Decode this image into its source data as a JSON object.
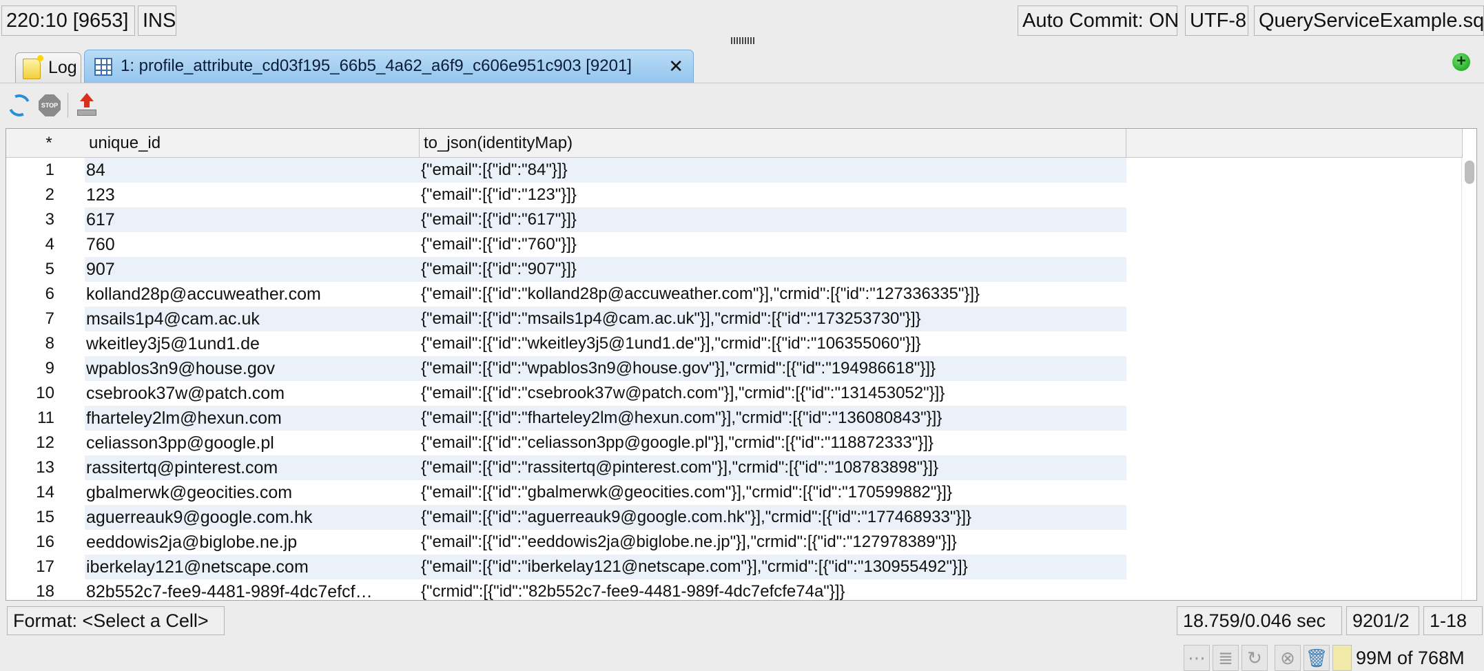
{
  "status_top": {
    "cursor_position": "220:10 [9653]",
    "insert_mode": "INS",
    "auto_commit": "Auto Commit: ON",
    "encoding": "UTF-8",
    "file_name": "QueryServiceExample.sql*"
  },
  "tabs": [
    {
      "label": "Log",
      "icon": "note-icon"
    },
    {
      "label": "1: profile_attribute_cd03f195_66b5_4a62_a6f9_c606e951c903 [9201]",
      "icon": "grid-icon",
      "close": "✕"
    }
  ],
  "toolbar": {
    "stop_label": "STOP"
  },
  "grid": {
    "columns": [
      "*",
      "unique_id",
      "to_json(identityMap)"
    ],
    "rows": [
      {
        "num": "1",
        "unique_id": "84",
        "identity": "{\"email\":[{\"id\":\"84\"}]}"
      },
      {
        "num": "2",
        "unique_id": "123",
        "identity": "{\"email\":[{\"id\":\"123\"}]}"
      },
      {
        "num": "3",
        "unique_id": "617",
        "identity": "{\"email\":[{\"id\":\"617\"}]}"
      },
      {
        "num": "4",
        "unique_id": "760",
        "identity": "{\"email\":[{\"id\":\"760\"}]}"
      },
      {
        "num": "5",
        "unique_id": "907",
        "identity": "{\"email\":[{\"id\":\"907\"}]}"
      },
      {
        "num": "6",
        "unique_id": "kolland28p@accuweather.com",
        "identity": "{\"email\":[{\"id\":\"kolland28p@accuweather.com\"}],\"crmid\":[{\"id\":\"127336335\"}]}"
      },
      {
        "num": "7",
        "unique_id": "msails1p4@cam.ac.uk",
        "identity": "{\"email\":[{\"id\":\"msails1p4@cam.ac.uk\"}],\"crmid\":[{\"id\":\"173253730\"}]}"
      },
      {
        "num": "8",
        "unique_id": "wkeitley3j5@1und1.de",
        "identity": "{\"email\":[{\"id\":\"wkeitley3j5@1und1.de\"}],\"crmid\":[{\"id\":\"106355060\"}]}"
      },
      {
        "num": "9",
        "unique_id": "wpablos3n9@house.gov",
        "identity": "{\"email\":[{\"id\":\"wpablos3n9@house.gov\"}],\"crmid\":[{\"id\":\"194986618\"}]}"
      },
      {
        "num": "10",
        "unique_id": "csebrook37w@patch.com",
        "identity": "{\"email\":[{\"id\":\"csebrook37w@patch.com\"}],\"crmid\":[{\"id\":\"131453052\"}]}"
      },
      {
        "num": "11",
        "unique_id": "fharteley2lm@hexun.com",
        "identity": "{\"email\":[{\"id\":\"fharteley2lm@hexun.com\"}],\"crmid\":[{\"id\":\"136080843\"}]}"
      },
      {
        "num": "12",
        "unique_id": "celiasson3pp@google.pl",
        "identity": "{\"email\":[{\"id\":\"celiasson3pp@google.pl\"}],\"crmid\":[{\"id\":\"118872333\"}]}"
      },
      {
        "num": "13",
        "unique_id": "rassitertq@pinterest.com",
        "identity": "{\"email\":[{\"id\":\"rassitertq@pinterest.com\"}],\"crmid\":[{\"id\":\"108783898\"}]}"
      },
      {
        "num": "14",
        "unique_id": "gbalmerwk@geocities.com",
        "identity": "{\"email\":[{\"id\":\"gbalmerwk@geocities.com\"}],\"crmid\":[{\"id\":\"170599882\"}]}"
      },
      {
        "num": "15",
        "unique_id": "aguerreauk9@google.com.hk",
        "identity": "{\"email\":[{\"id\":\"aguerreauk9@google.com.hk\"}],\"crmid\":[{\"id\":\"177468933\"}]}"
      },
      {
        "num": "16",
        "unique_id": "eeddowis2ja@biglobe.ne.jp",
        "identity": "{\"email\":[{\"id\":\"eeddowis2ja@biglobe.ne.jp\"}],\"crmid\":[{\"id\":\"127978389\"}]}"
      },
      {
        "num": "17",
        "unique_id": "iberkelay121@netscape.com",
        "identity": "{\"email\":[{\"id\":\"iberkelay121@netscape.com\"}],\"crmid\":[{\"id\":\"130955492\"}]}"
      },
      {
        "num": "18",
        "unique_id": "82b552c7-fee9-4481-989f-4dc7efcf…",
        "identity": "{\"crmid\":[{\"id\":\"82b552c7-fee9-4481-989f-4dc7efcfe74a\"}]}"
      }
    ]
  },
  "bottom": {
    "format": "Format: <Select a Cell>",
    "timing": "18.759/0.046 sec",
    "position": "9201/2",
    "range": "1-18"
  },
  "status_bottom": {
    "memory": "99M of 768M",
    "icons": [
      "gc-icon",
      "stack-icon",
      "refresh-icon",
      "cancel-icon",
      "trash-icon"
    ]
  },
  "colors": {
    "active_tab": "#94c5ef",
    "alt_row": "#ebf1f8",
    "add_button": "#0d9b0d",
    "export_arrow": "#d9301e",
    "refresh": "#2a8fd6"
  }
}
